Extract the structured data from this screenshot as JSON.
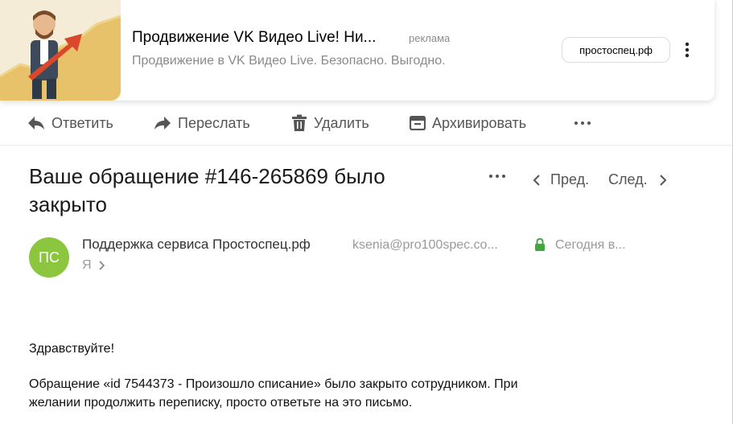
{
  "ad": {
    "title": "Продвижение VK Видео Live! Ни...",
    "label": "реклама",
    "description": "Продвижение в VK Видео Live. Безопасно. Выгодно.",
    "domain": "простоспец.рф"
  },
  "toolbar": {
    "reply": "Ответить",
    "forward": "Переслать",
    "delete": "Удалить",
    "archive": "Архивировать"
  },
  "message": {
    "subject": "Ваше обращение #146-265869 было закрыто",
    "prev": "Пред.",
    "next": "След.",
    "avatar_initials": "ПС",
    "avatar_color": "#8cc63e",
    "sender_name": "Поддержка сервиса Простоспец.рф",
    "sender_email": "ksenia@pro100spec.co...",
    "date": "Сегодня в...",
    "recipient": "Я",
    "greeting": "Здравствуйте!",
    "paragraph_line1": "Обращение «id 7544373 - Произошло списание» было закрыто сотрудником. При",
    "paragraph_line2": "желании продолжить переписку, просто ответьте на это письмо."
  }
}
